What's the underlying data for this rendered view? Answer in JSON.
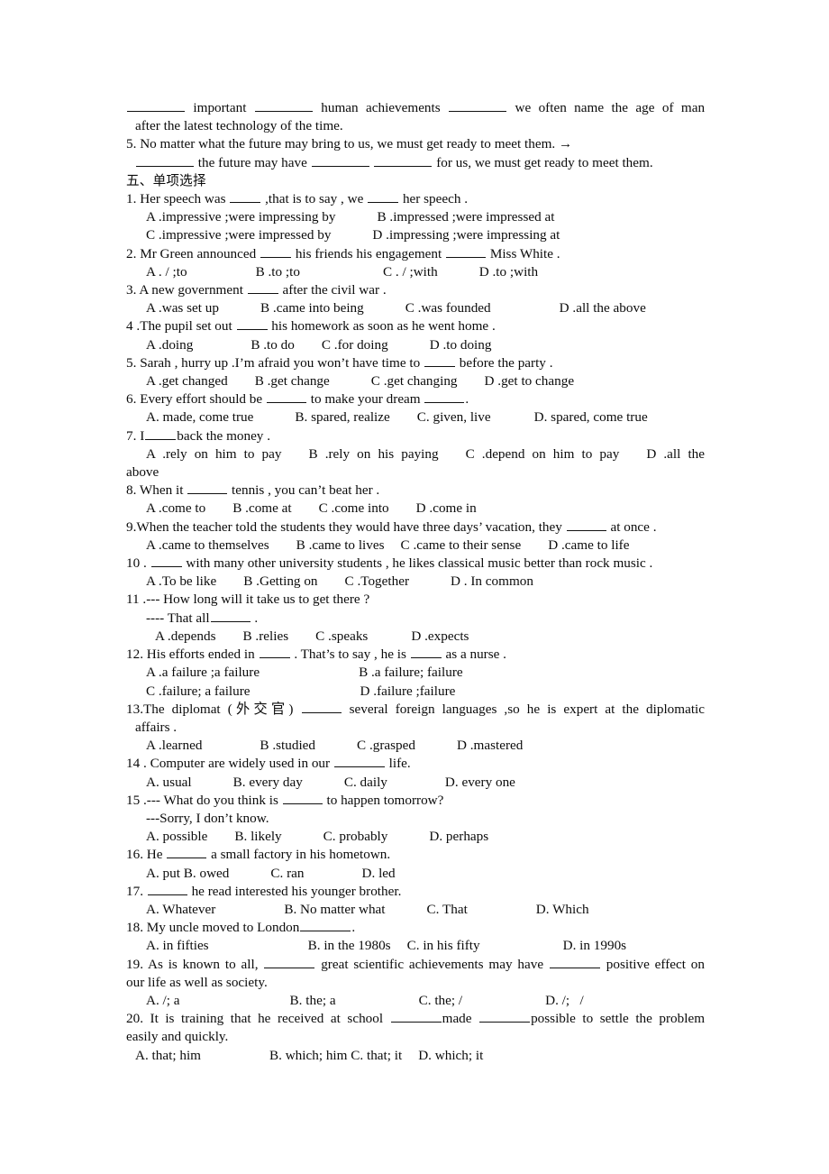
{
  "document": {
    "type": "english-grammar-worksheet-page",
    "page_background": "#ffffff",
    "text_color": "#0b0b0b"
  },
  "carryover": {
    "q4_line1_a": "important",
    "q4_line1_b": "human achievements",
    "q4_line1_c": "we often name the age of man",
    "q4_line2": "after the latest technology of the time.",
    "q5_prompt": "5. No matter what the future may bring to us, we must get ready to meet them. →",
    "q5_answer_a": "the future may have",
    "q5_answer_b": "for us, we must get ready to meet them."
  },
  "section": {
    "heading": "五、单项选择"
  },
  "questions": [
    {
      "number": "1.",
      "stem_a": "1. Her speech was",
      "stem_b": ",that is to say , we",
      "stem_c": "her speech .",
      "options_line1": [
        "A .impressive ;were impressing by",
        "B .impressed ;were impressed at"
      ],
      "options_line2": [
        "C .impressive ;were impressed by",
        "D .impressing ;were impressing at"
      ]
    },
    {
      "number": "2.",
      "stem_a": "2. Mr Green announced",
      "stem_b": "his friends his engagement",
      "stem_c": "Miss White .",
      "options": [
        "A . / ;to",
        "B .to ;to",
        "C . / ;with",
        "D .to ;with"
      ]
    },
    {
      "number": "3.",
      "stem_a": "3. A new government",
      "stem_b": "after the civil war .",
      "options": [
        "A .was set up",
        "B .came into being",
        "C .was founded",
        "D .all the above"
      ]
    },
    {
      "number": "4.",
      "stem_a": "4 .The pupil set out",
      "stem_b": "his homework as soon as he went home .",
      "options": [
        "A .doing",
        "B .to do",
        "C .for doing",
        "D .to doing"
      ]
    },
    {
      "number": "5.",
      "stem_a": "5. Sarah , hurry up .I’m afraid you won’t have time to",
      "stem_b": "before the party .",
      "options": [
        "A .get changed",
        "B .get change",
        "C .get changing",
        "D .get to change"
      ]
    },
    {
      "number": "6.",
      "stem_a": "6. Every effort should be",
      "stem_b": "to make your dream",
      "stem_c": ".",
      "options": [
        "A. made, come true",
        "B. spared, realize",
        "C. given, live",
        "D. spared, come true"
      ]
    },
    {
      "number": "7.",
      "stem_a": "7. I",
      "stem_b": "back the money .",
      "options": [
        "A .rely on him to pay",
        "B .rely on his paying",
        "C .depend on him to pay",
        "D",
        ".all",
        "the"
      ],
      "options_wrap": "above"
    },
    {
      "number": "8.",
      "stem_a": "8. When it",
      "stem_b": "tennis , you can’t beat her .",
      "options": [
        "A .come to",
        "B .come at",
        "C .come into",
        "D .come in"
      ]
    },
    {
      "number": "9.",
      "stem_a": "9.When the teacher told the students they would have three days’ vacation, they",
      "stem_b": "at once .",
      "options": [
        "A .came to themselves",
        "B .came to lives",
        "C .came to their sense",
        "D .came to life"
      ]
    },
    {
      "number": "10.",
      "stem_a": "10 .",
      "stem_b": "with many other university students , he likes classical music better than rock music .",
      "options": [
        "A .To be like",
        "B .Getting on",
        "C .Together",
        "D . In common"
      ]
    },
    {
      "number": "11.",
      "stem_a": "11 .--- How long will it take us to get there ?",
      "stem_b": "---- That all",
      "stem_c": ".",
      "options": [
        "A .depends",
        "B .relies",
        "C .speaks",
        "D .expects"
      ]
    },
    {
      "number": "12.",
      "stem_a": "12. His efforts ended in",
      "stem_b": ". That’s to say , he is",
      "stem_c": "as a nurse .",
      "options_line1": [
        "A .a failure ;a failure",
        "B .a failure; failure"
      ],
      "options_line2": [
        "C .failure; a failure",
        "D .failure ;failure"
      ]
    },
    {
      "number": "13.",
      "stem_a": "13.The diplomat (外交官)",
      "stem_b": "several foreign languages ,so he is expert at the diplomatic",
      "stem_wrap": "affairs .",
      "options": [
        "A .learned",
        "B .studied",
        "C .grasped",
        "D .mastered"
      ]
    },
    {
      "number": "14.",
      "stem_a": "14 . Computer are widely used in our",
      "stem_b": "life.",
      "options": [
        "A. usual",
        "B. every day",
        "C. daily",
        "D. every one"
      ]
    },
    {
      "number": "15.",
      "stem_a": "15 .--- What do you think is",
      "stem_b": "to happen tomorrow?",
      "stem_c": "---Sorry, I don’t know.",
      "options": [
        "A. possible",
        "B. likely",
        "C. probably",
        "D. perhaps"
      ]
    },
    {
      "number": "16.",
      "stem_a": "16. He",
      "stem_b": "a small factory in his hometown.",
      "options": [
        "A. put",
        "B. owed",
        "C. ran",
        "D. led"
      ]
    },
    {
      "number": "17.",
      "stem_a": "17.",
      "stem_b": "he read interested his younger brother.",
      "options": [
        "A. Whatever",
        "B. No matter what",
        "C. That",
        "D. Which"
      ]
    },
    {
      "number": "18.",
      "stem_a": "18. My uncle moved to London",
      "stem_b": ".",
      "options": [
        "A. in fifties",
        "B. in the 1980s",
        "C. in his fifty",
        "D. in 1990s"
      ]
    },
    {
      "number": "19.",
      "stem_a": "19. As is known to all,",
      "stem_b": "great scientific achievements may have",
      "stem_c": "positive effect on",
      "stem_wrap": "our life as well as society.",
      "options": [
        "A. /; a",
        "B. the; a",
        "C. the; /",
        "D. /;   /"
      ]
    },
    {
      "number": "20.",
      "stem_a": "20. It is training that he received at school",
      "stem_b": "made",
      "stem_c": "possible to settle the problem",
      "stem_wrap": "easily and quickly.",
      "options": [
        "A. that; him",
        "B. which; him",
        "C. that; it",
        "D. which; it"
      ]
    }
  ]
}
